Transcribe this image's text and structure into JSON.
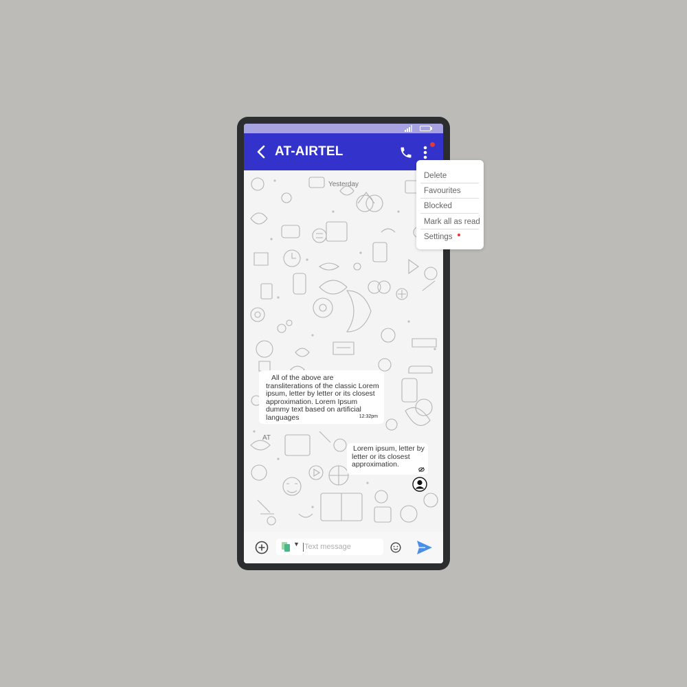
{
  "app": {
    "title": "AT-AIRTEL"
  },
  "colors": {
    "app_bar": "#3333cc",
    "status_bar": "#a6a3e0",
    "notification_dot": "#e53935",
    "send_accent": "#4a8fe7"
  },
  "icons": {
    "back": "chevron-left-icon",
    "call": "phone-icon",
    "more": "more-vertical-icon",
    "add": "add-circle-icon",
    "sim": "sim-card-icon",
    "emoji": "emoji-icon",
    "send": "send-icon",
    "avatar": "user-avatar-icon",
    "seen": "seen-icon"
  },
  "chat": {
    "date_label": "Yesterday",
    "sender_label": "AT",
    "messages": [
      {
        "direction": "incoming",
        "text": "All of the above are transliterations of the classic Lorem ipsum, letter by letter or its closest approximation. Lorem Ipsum dummy text based on artificial languages",
        "time": "12:32pm"
      },
      {
        "direction": "outgoing",
        "text": "Lorem ipsum, letter by letter or its closest approximation."
      }
    ]
  },
  "composer": {
    "placeholder": "Text message",
    "value": ""
  },
  "menu": {
    "items": [
      {
        "label": "Delete"
      },
      {
        "label": "Favourites"
      },
      {
        "label": "Blocked"
      },
      {
        "label": "Mark all as read"
      },
      {
        "label": "Settings"
      }
    ]
  }
}
